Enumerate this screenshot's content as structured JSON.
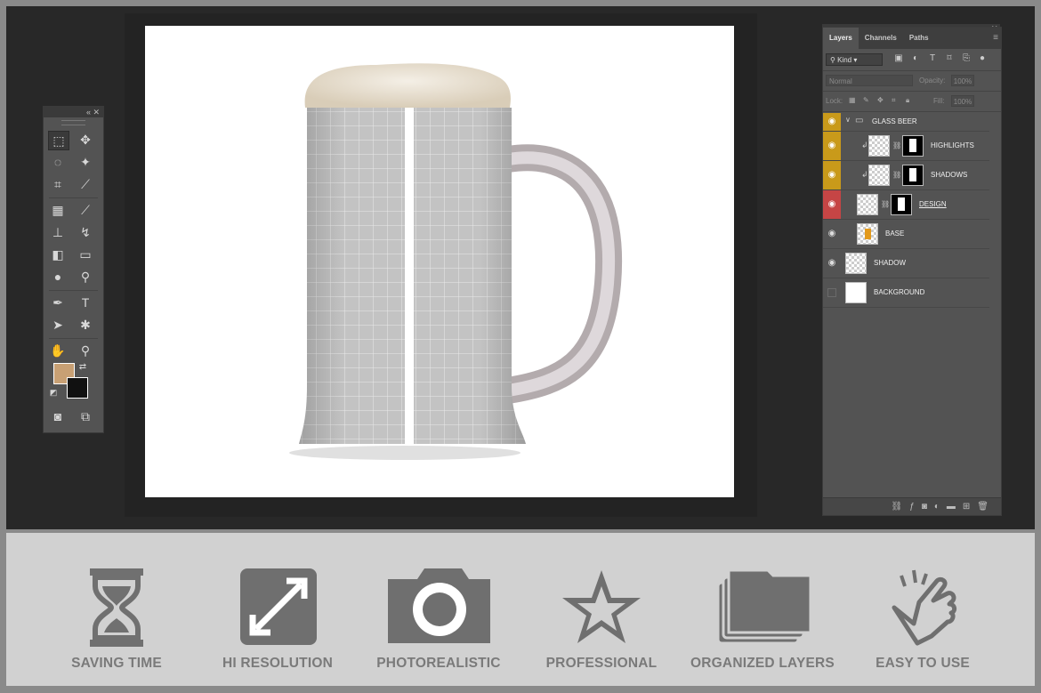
{
  "layers_panel": {
    "tabs": [
      "Layers",
      "Channels",
      "Paths"
    ],
    "filter_kind": "Kind",
    "blend_mode": "Normal",
    "opacity_label": "Opacity:",
    "opacity_value": "100%",
    "lock_label": "Lock:",
    "fill_label": "Fill:",
    "fill_value": "100%",
    "layers": [
      {
        "name": "GLASS BEER"
      },
      {
        "name": "HIGHLIGHTS"
      },
      {
        "name": "SHADOWS"
      },
      {
        "name": "DESIGN"
      },
      {
        "name": "BASE"
      },
      {
        "name": "SHADOW"
      },
      {
        "name": "BACKGROUND"
      }
    ]
  },
  "colors": {
    "foreground": "#c8a074",
    "background": "#111111",
    "visible_gold": "#c99a1a",
    "visible_red": "#c64545"
  },
  "features": [
    {
      "label": "SAVING TIME",
      "icon": "hourglass-icon"
    },
    {
      "label": "HI RESOLUTION",
      "icon": "expand-icon"
    },
    {
      "label": "PHOTOREALISTIC",
      "icon": "camera-icon"
    },
    {
      "label": "PROFESSIONAL",
      "icon": "star-icon"
    },
    {
      "label": "ORGANIZED LAYERS",
      "icon": "folders-icon"
    },
    {
      "label": "EASY TO USE",
      "icon": "hand-tap-icon"
    }
  ]
}
